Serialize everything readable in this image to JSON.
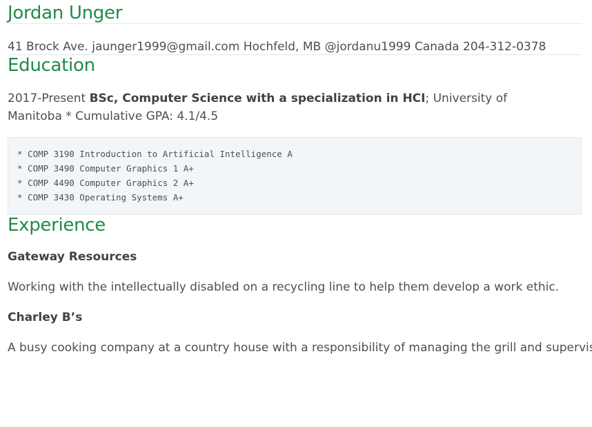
{
  "header": {
    "name": "Jordan Unger",
    "contact": "41 Brock Ave. jaunger1999@gmail.com Hochfeld, MB @jordanu1999 Canada 204-312-0378"
  },
  "education": {
    "title": "Education",
    "period": "2017-Present",
    "degree": "BSc, Computer Science with a specialization in HCI",
    "institution_suffix": "; University of Manitoba * Cumulative GPA: 4.1/4.5",
    "courses": [
      "* COMP 3190 Introduction to Artificial Intelligence A",
      "* COMP 3490 Computer Graphics 1 A+",
      "* COMP 4490 Computer Graphics 2 A+",
      "* COMP 3430 Operating Systems A+"
    ]
  },
  "experience": {
    "title": "Experience",
    "jobs": [
      {
        "employer": "Gateway Resources",
        "description": "Working with the intellectually disabled on a recycling line to help them develop a work ethic."
      },
      {
        "employer": "Charley B’s",
        "description": "A busy cooking company at a country house with a responsibility of managing the grill and supervising the"
      }
    ]
  }
}
